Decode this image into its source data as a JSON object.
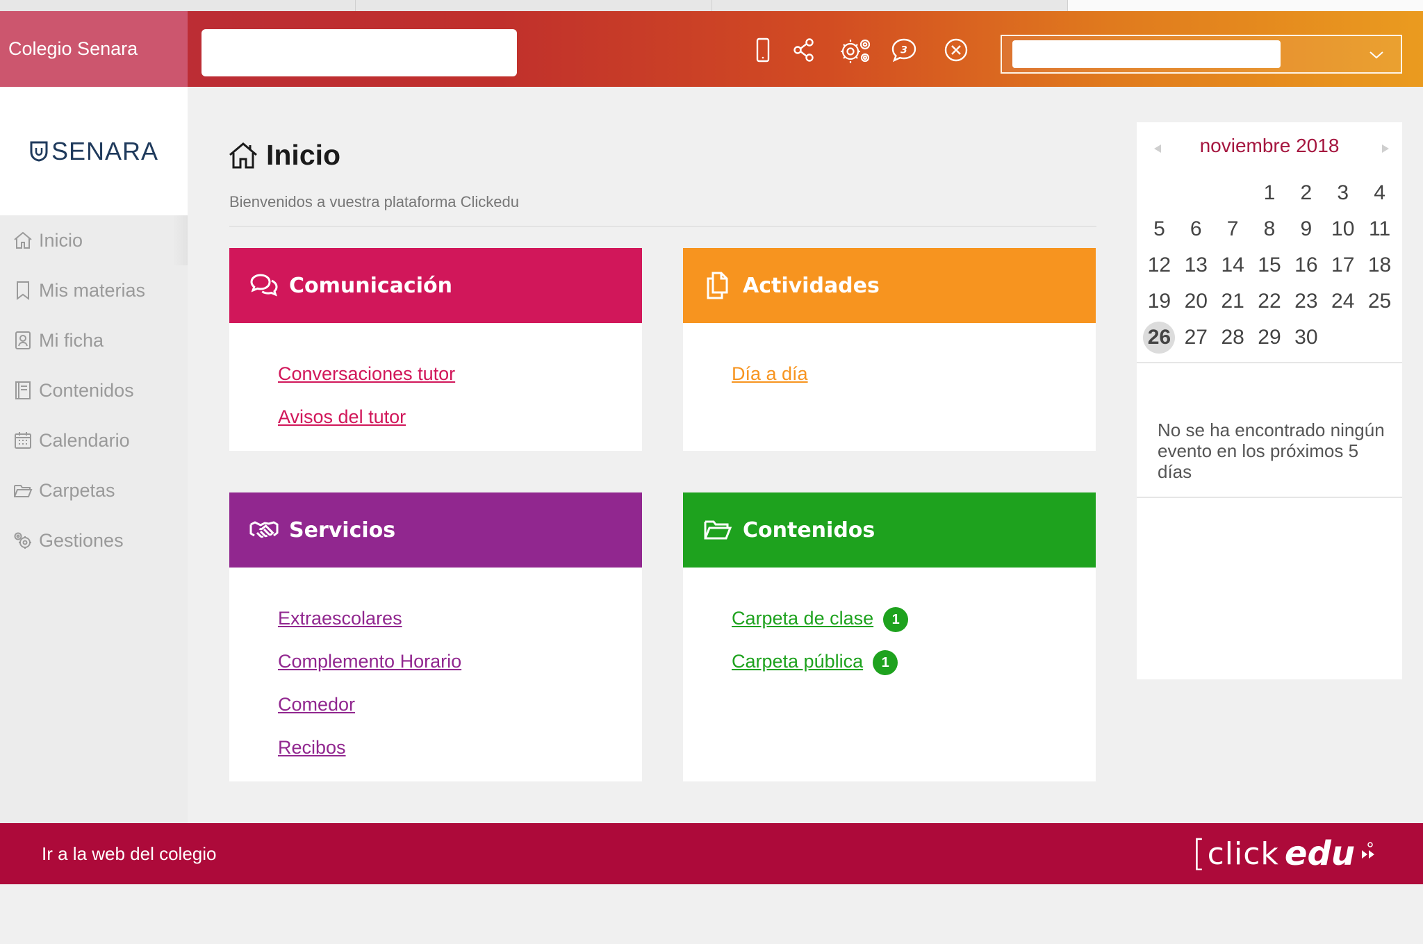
{
  "header": {
    "school_name": "Colegio Senara",
    "search_placeholder": "",
    "icons": [
      "mobile-icon",
      "share-icon",
      "settings-icon",
      "chat-icon",
      "close-icon"
    ],
    "chat_count": "3"
  },
  "sidebar": {
    "logo_text": "SENARA",
    "items": [
      {
        "label": "Inicio",
        "icon": "home-icon"
      },
      {
        "label": "Mis materias",
        "icon": "bookmark-icon"
      },
      {
        "label": "Mi ficha",
        "icon": "profile-card-icon"
      },
      {
        "label": "Contenidos",
        "icon": "book-icon"
      },
      {
        "label": "Calendario",
        "icon": "calendar-icon"
      },
      {
        "label": "Carpetas",
        "icon": "folder-icon"
      },
      {
        "label": "Gestiones",
        "icon": "gears-icon"
      }
    ]
  },
  "main": {
    "title": "Inicio",
    "subtitle": "Bienvenidos a vuestra plataforma Clickedu",
    "cards": {
      "comunicacion": {
        "title": "Comunicación",
        "color": "#d1175a",
        "links": [
          "Conversaciones tutor",
          "Avisos del tutor"
        ]
      },
      "actividades": {
        "title": "Actividades",
        "color": "#f7941f",
        "links": [
          "Día a día"
        ]
      },
      "servicios": {
        "title": "Servicios",
        "color": "#91278f",
        "links": [
          "Extraescolares",
          "Complemento Horario",
          "Comedor",
          "Recibos"
        ]
      },
      "contenidos": {
        "title": "Contenidos",
        "color": "#1ea21e",
        "links": [
          {
            "label": "Carpeta de clase",
            "badge": "1"
          },
          {
            "label": "Carpeta pública",
            "badge": "1"
          }
        ]
      }
    }
  },
  "calendar": {
    "month_label": "noviembre 2018",
    "today": "26",
    "leading_blanks": 3,
    "days": [
      "1",
      "2",
      "3",
      "4",
      "5",
      "6",
      "7",
      "8",
      "9",
      "10",
      "11",
      "12",
      "13",
      "14",
      "15",
      "16",
      "17",
      "18",
      "19",
      "20",
      "21",
      "22",
      "23",
      "24",
      "25",
      "26",
      "27",
      "28",
      "29",
      "30"
    ],
    "empty_message": "No se ha encontrado ningún evento en los próximos 5 días"
  },
  "footer": {
    "link": "Ir a la web del colegio",
    "logo_click": "click",
    "logo_edu": "edu"
  }
}
